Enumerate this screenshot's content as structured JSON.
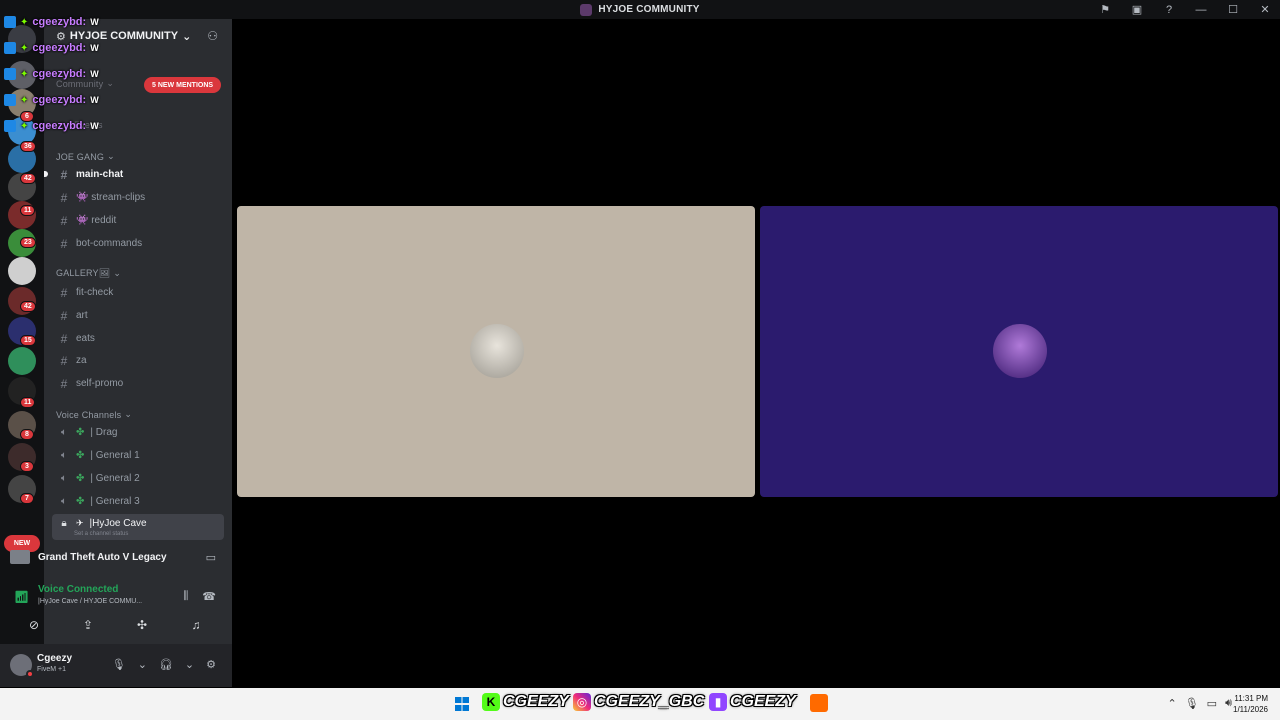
{
  "window": {
    "title": "HYJOE COMMUNITY"
  },
  "server": {
    "name": "HYJOE COMMUNITY",
    "mentions_pill": "5 NEW MENTIONS"
  },
  "rail_badges": [
    "6",
    "36",
    "42",
    "11",
    "23",
    "42",
    "15",
    "11",
    "8",
    "3",
    "7"
  ],
  "rail_new": "NEW",
  "overlay": {
    "user": "cgeezybd:",
    "badge": "W"
  },
  "hidden_items": [
    "Community",
    "Events"
  ],
  "categories": {
    "joe_gang": "JOE GANG",
    "gallery": "GALLERY🖼",
    "voice": "Voice Channels"
  },
  "text_channels": [
    {
      "name": "main-chat"
    },
    {
      "name": "👾 stream-clips"
    },
    {
      "name": "👾 reddit"
    },
    {
      "name": "bot-commands"
    }
  ],
  "gallery_channels": [
    {
      "name": "fit-check"
    },
    {
      "name": "art"
    },
    {
      "name": "eats"
    },
    {
      "name": "za"
    },
    {
      "name": "self-promo"
    }
  ],
  "voice_channels": [
    {
      "name": "| Drag"
    },
    {
      "name": "| General 1"
    },
    {
      "name": "| General 2"
    },
    {
      "name": "| General 3"
    }
  ],
  "current_voice": {
    "name": "|HyJoe Cave",
    "status_hint": "Set a channel status"
  },
  "activity": {
    "game": "Grand Theft Auto V Legacy"
  },
  "voice_status": {
    "label": "Voice Connected",
    "channel": "|HyJoe Cave / HYJOE COMMU..."
  },
  "user": {
    "name": "Cgeezy",
    "status": "FiveM +1"
  },
  "colors": {
    "tile_left": "#bfb5a7",
    "tile_right": "#2b1b6e",
    "accent_red": "#da373c",
    "connected_green": "#23a559"
  },
  "taskbar": {
    "kick": "CGEEZY",
    "instagram": "CGEEZY_GBC",
    "twitch": "CGEEZY",
    "time": "11:31 PM",
    "date": "1/11/2026"
  }
}
